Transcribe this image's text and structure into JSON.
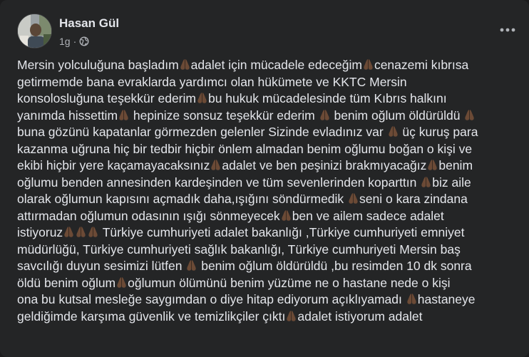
{
  "post": {
    "author": "Hasan Gül",
    "time": "1g",
    "separator": "·",
    "privacy_icon": "globe-icon",
    "more_icon": "more-options-icon",
    "emoji_icon": "folded-hands-icon",
    "lines": [
      [
        "Mersin yolculuğuna başladım",
        "🙏",
        "adalet için mücadele edeceğim",
        "🙏",
        "cenazemi kıbrısa"
      ],
      [
        "getirmemde bana evraklarda yardımcı olan hükümete ve KKTC Mersin"
      ],
      [
        "konsolosluğuna teşekkür ederim",
        "🙏",
        "bu hukuk mücadelesinde tüm Kıbrıs halkını"
      ],
      [
        "yanımda hissettim",
        "🙏",
        " hepinize sonsuz teşekkür ederim ",
        "🙏",
        " benim oğlum öldürüldü ",
        "🙏"
      ],
      [
        "buna gözünü kapatanlar görmezden gelenler Sizinde evladınız var ",
        "🙏",
        " üç kuruş para"
      ],
      [
        "kazanma uğruna hiç bir tedbir hiçbir önlem almadan benim oğlumu boğan o kişi ve"
      ],
      [
        "ekibi hiçbir yere kaçamayacaksınız",
        "🙏",
        "adalet ve ben peşinizi brakmıyacağız",
        "🙏",
        "benim"
      ],
      [
        "oğlumu benden annesinden kardeşinden ve tüm sevenlerinden koparttın ",
        "🙏",
        "biz aile"
      ],
      [
        "olarak oğlumun kapısını açmadık daha,ışığını söndürmedik ",
        "🙏",
        "seni o kara zindana"
      ],
      [
        "attırmadan oğlumun odasının ışığı sönmeyecek",
        "🙏",
        "ben ve ailem sadece adalet"
      ],
      [
        "istiyoruz",
        "🙏",
        "🙏",
        "🙏",
        " Türkiye cumhuriyeti adalet bakanlığı ,Türkiye cumhuriyeti emniyet"
      ],
      [
        "müdürlüğü, Türkiye cumhuriyeti sağlık bakanlığı, Türkiye cumhuriyeti Mersin baş"
      ],
      [
        "savcılığı duyun sesimizi lütfen ",
        "🙏",
        " benim oğlum öldürüldü ,bu resimden 10 dk sonra"
      ],
      [
        "öldü benim oğlum",
        "🙏",
        "oğlumun ölümünü benim yüzüme ne o hastane nede o kişi"
      ],
      [
        "ona bu kutsal mesleğe saygımdan o diye hitap ediyorum açıklıyamadı ",
        "🙏",
        "hastaneye"
      ],
      [
        "geldiğimde karşıma güvenlik ve temizlikçiler çıktı",
        "🙏",
        "adalet istiyorum adalet"
      ]
    ]
  },
  "colors": {
    "card_bg": "#242526",
    "text_primary": "#e4e6eb",
    "text_secondary": "#b0b3b8",
    "emoji_skin": "#6b4a36"
  }
}
